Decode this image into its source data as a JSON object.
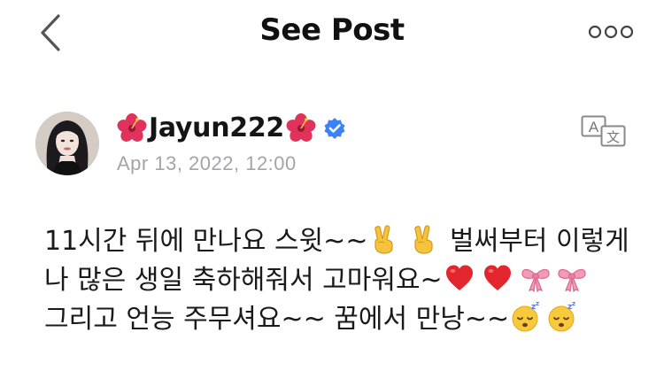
{
  "header": {
    "title": "See Post",
    "back_icon": "chevron-left-icon",
    "more_icon": "more-horizontal-icon"
  },
  "post": {
    "author": {
      "name": "Jayun222",
      "name_prefix_icon": "hibiscus-icon",
      "name_suffix_icon": "hibiscus-icon",
      "verified_icon": "verified-badge-icon",
      "avatar": "avatar-photo"
    },
    "timestamp": "Apr 13, 2022, 12:00",
    "translate_icon": "translate-icon",
    "lines": [
      {
        "text_before": "11시간 뒤에 만나요 스윗~~",
        "emojis_mid": [
          "victory-hand-emoji",
          "victory-hand-emoji"
        ],
        "text_after": " 벌써부터 이렇게"
      },
      {
        "text_before": "나 많은 생일 축하해줘서 고마워요~",
        "emojis_end": [
          "red-heart-emoji",
          "red-heart-emoji",
          "ribbon-emoji",
          "ribbon-emoji"
        ]
      },
      {
        "text_before": "그리고 언능 주무셔요~~ 꿈에서 만낭~~",
        "emojis_end": [
          "sleeping-face-emoji",
          "sleeping-face-emoji"
        ]
      }
    ]
  },
  "colors": {
    "background": "#ffffff",
    "text": "#111111",
    "timestamp": "#a4a4a8",
    "verified": "#3b82f6",
    "icon_gray": "#666666"
  }
}
